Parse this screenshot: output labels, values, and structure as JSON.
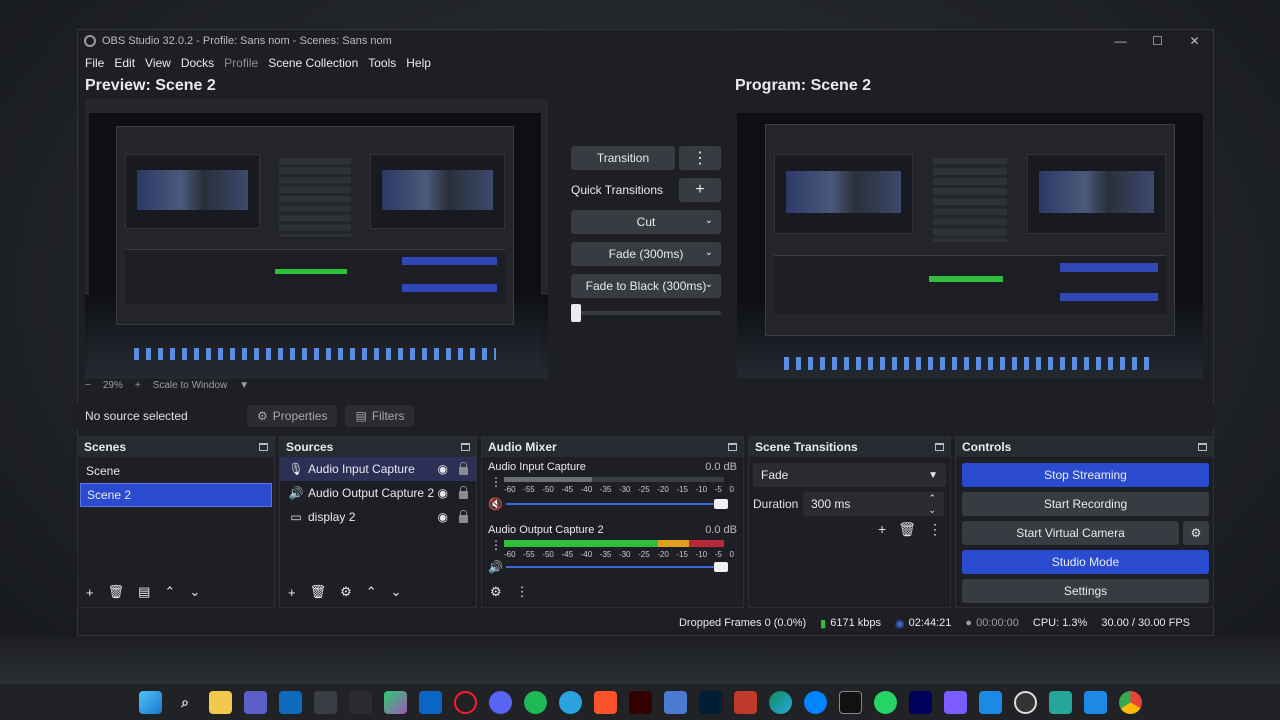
{
  "window": {
    "title": "OBS Studio 32.0.2 - Profile: Sans nom - Scenes: Sans nom",
    "controls": [
      "—",
      "☐",
      "✕"
    ]
  },
  "menu": [
    "File",
    "Edit",
    "View",
    "Docks",
    "Profile",
    "Scene Collection",
    "Tools",
    "Help"
  ],
  "preview": {
    "title": "Preview: Scene 2",
    "zoom": "29%",
    "scale_mode": "Scale to Window"
  },
  "program": {
    "title": "Program: Scene 2"
  },
  "transitions_panel": {
    "transition_label": "Transition",
    "quick_transitions_label": "Quick Transitions",
    "quick_items": [
      "Cut",
      "Fade (300ms)",
      "Fade to Black (300ms)"
    ],
    "tbar_value": 0
  },
  "source_toolbar": {
    "status": "No source selected",
    "properties_label": "Properties",
    "filters_label": "Filters"
  },
  "scenes": {
    "title": "Scenes",
    "items": [
      "Scene",
      "Scene 2"
    ],
    "selected": "Scene 2"
  },
  "sources": {
    "title": "Sources",
    "items": [
      {
        "name": "Audio Input Capture",
        "icon": "microphone-icon"
      },
      {
        "name": "Audio Output Capture 2",
        "icon": "speaker-icon"
      },
      {
        "name": "display 2",
        "icon": "monitor-icon"
      }
    ],
    "selected": "Audio Input Capture"
  },
  "audio_mixer": {
    "title": "Audio Mixer",
    "scale": [
      "-60",
      "-55",
      "-50",
      "-45",
      "-40",
      "-35",
      "-30",
      "-25",
      "-20",
      "-15",
      "-10",
      "-5",
      "0"
    ],
    "channels": [
      {
        "name": "Audio Input Capture",
        "db": "0.0 dB",
        "level": 0.0,
        "muted": true
      },
      {
        "name": "Audio Output Capture 2",
        "db": "0.0 dB",
        "level": 0.9,
        "muted": false
      }
    ]
  },
  "scene_transitions": {
    "title": "Scene Transitions",
    "selected": "Fade",
    "duration_label": "Duration",
    "duration_value": "300 ms"
  },
  "controls": {
    "title": "Controls",
    "buttons": {
      "stop_streaming": "Stop Streaming",
      "start_recording": "Start Recording",
      "start_virtual_camera": "Start Virtual Camera",
      "studio_mode": "Studio Mode",
      "settings": "Settings"
    }
  },
  "status": {
    "dropped_frames": "Dropped Frames 0 (0.0%)",
    "bitrate": "6171 kbps",
    "stream_time": "02:44:21",
    "record_time": "00:00:00",
    "cpu": "CPU: 1.3%",
    "fps": "30.00 / 30.00 FPS"
  },
  "colors": {
    "accent": "#2a4bd0",
    "live_green": "#2fbf3a",
    "record_red": "#c43a3a"
  },
  "taskbar_icons": [
    "windows-start-icon",
    "search-icon",
    "file-explorer-icon",
    "teams-icon",
    "outlook-icon",
    "mail-icon",
    "chatgpt-icon",
    "copilot-icon",
    "linkedin-icon",
    "opera-icon",
    "discord-icon",
    "spotify-icon",
    "telegram-icon",
    "brave-icon",
    "illustrator-icon",
    "app-icon",
    "photoshop-icon",
    "snipping-tool-icon",
    "edge-icon",
    "messenger-icon",
    "terminal-icon",
    "whatsapp-icon",
    "after-effects-icon",
    "app-icon-2",
    "app-icon-3",
    "obs-icon",
    "app-icon-4",
    "app-icon-5",
    "chrome-icon"
  ]
}
